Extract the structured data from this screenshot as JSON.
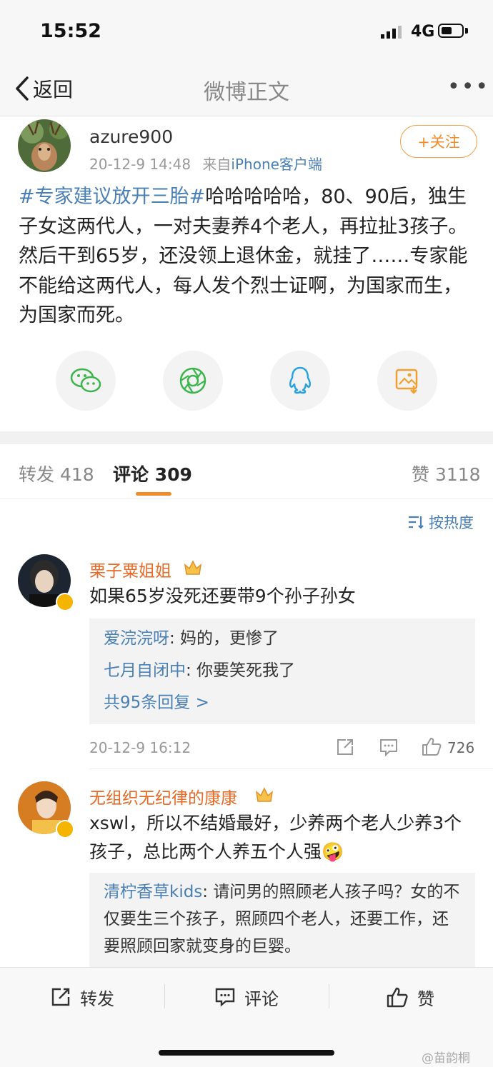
{
  "status": {
    "time": "15:52",
    "network": "4G"
  },
  "nav": {
    "back_label": "返回",
    "title": "微博正文",
    "more": "•••"
  },
  "post": {
    "username": "azure900",
    "date": "20-12-9 14:48",
    "source_prefix": "来自",
    "source": "iPhone客户端",
    "follow_label": "+关注",
    "hashtag": "#专家建议放开三胎#",
    "text": "哈哈哈哈哈，80、90后，独生子女这两代人，一对夫妻养4个老人，再拉扯3孩子。然后干到65岁，还没领上退休金，就挂了……专家能不能给这两代人，每人发个烈士证啊，为国家而生，为国家而死。"
  },
  "share_icons": [
    "wechat-icon",
    "moments-icon",
    "qq-icon",
    "save-image-icon"
  ],
  "tabs": {
    "repost_label": "转发",
    "repost_count": "418",
    "comment_label": "评论",
    "comment_count": "309",
    "like_label": "赞",
    "like_count": "3118"
  },
  "sort_label": "按热度",
  "comments": [
    {
      "name": "栗子粟姐姐",
      "text": "如果65岁没死还要带9个孙子孙女",
      "replies": [
        {
          "name": "爱浣浣呀",
          "text": ": 妈的，更惨了"
        },
        {
          "name": "七月自闭中",
          "text": ": 你要笑死我了"
        }
      ],
      "more_replies": "共95条回复 >",
      "time": "20-12-9 16:12",
      "likes": "726"
    },
    {
      "name": "无组织无纪律的康康",
      "text": "xswl，所以不结婚最好，少养两个老人少养3个孩子，总比两个人养五个人强",
      "emoji": "🤪",
      "replies": [
        {
          "name": "清柠香草kids",
          "text": ": 请问男的照顾老人孩子吗？女的不仅要生三个孩子，照顾四个老人，还要工作，还要照顾回家就变身的巨婴。"
        }
      ]
    }
  ],
  "bottom_bar": {
    "repost": "转发",
    "comment": "评论",
    "like": "赞"
  },
  "watermark": "@苗韵桐",
  "colors": {
    "accent": "#f08b2b",
    "link": "#4a7fb5",
    "name": "#e86a26"
  }
}
